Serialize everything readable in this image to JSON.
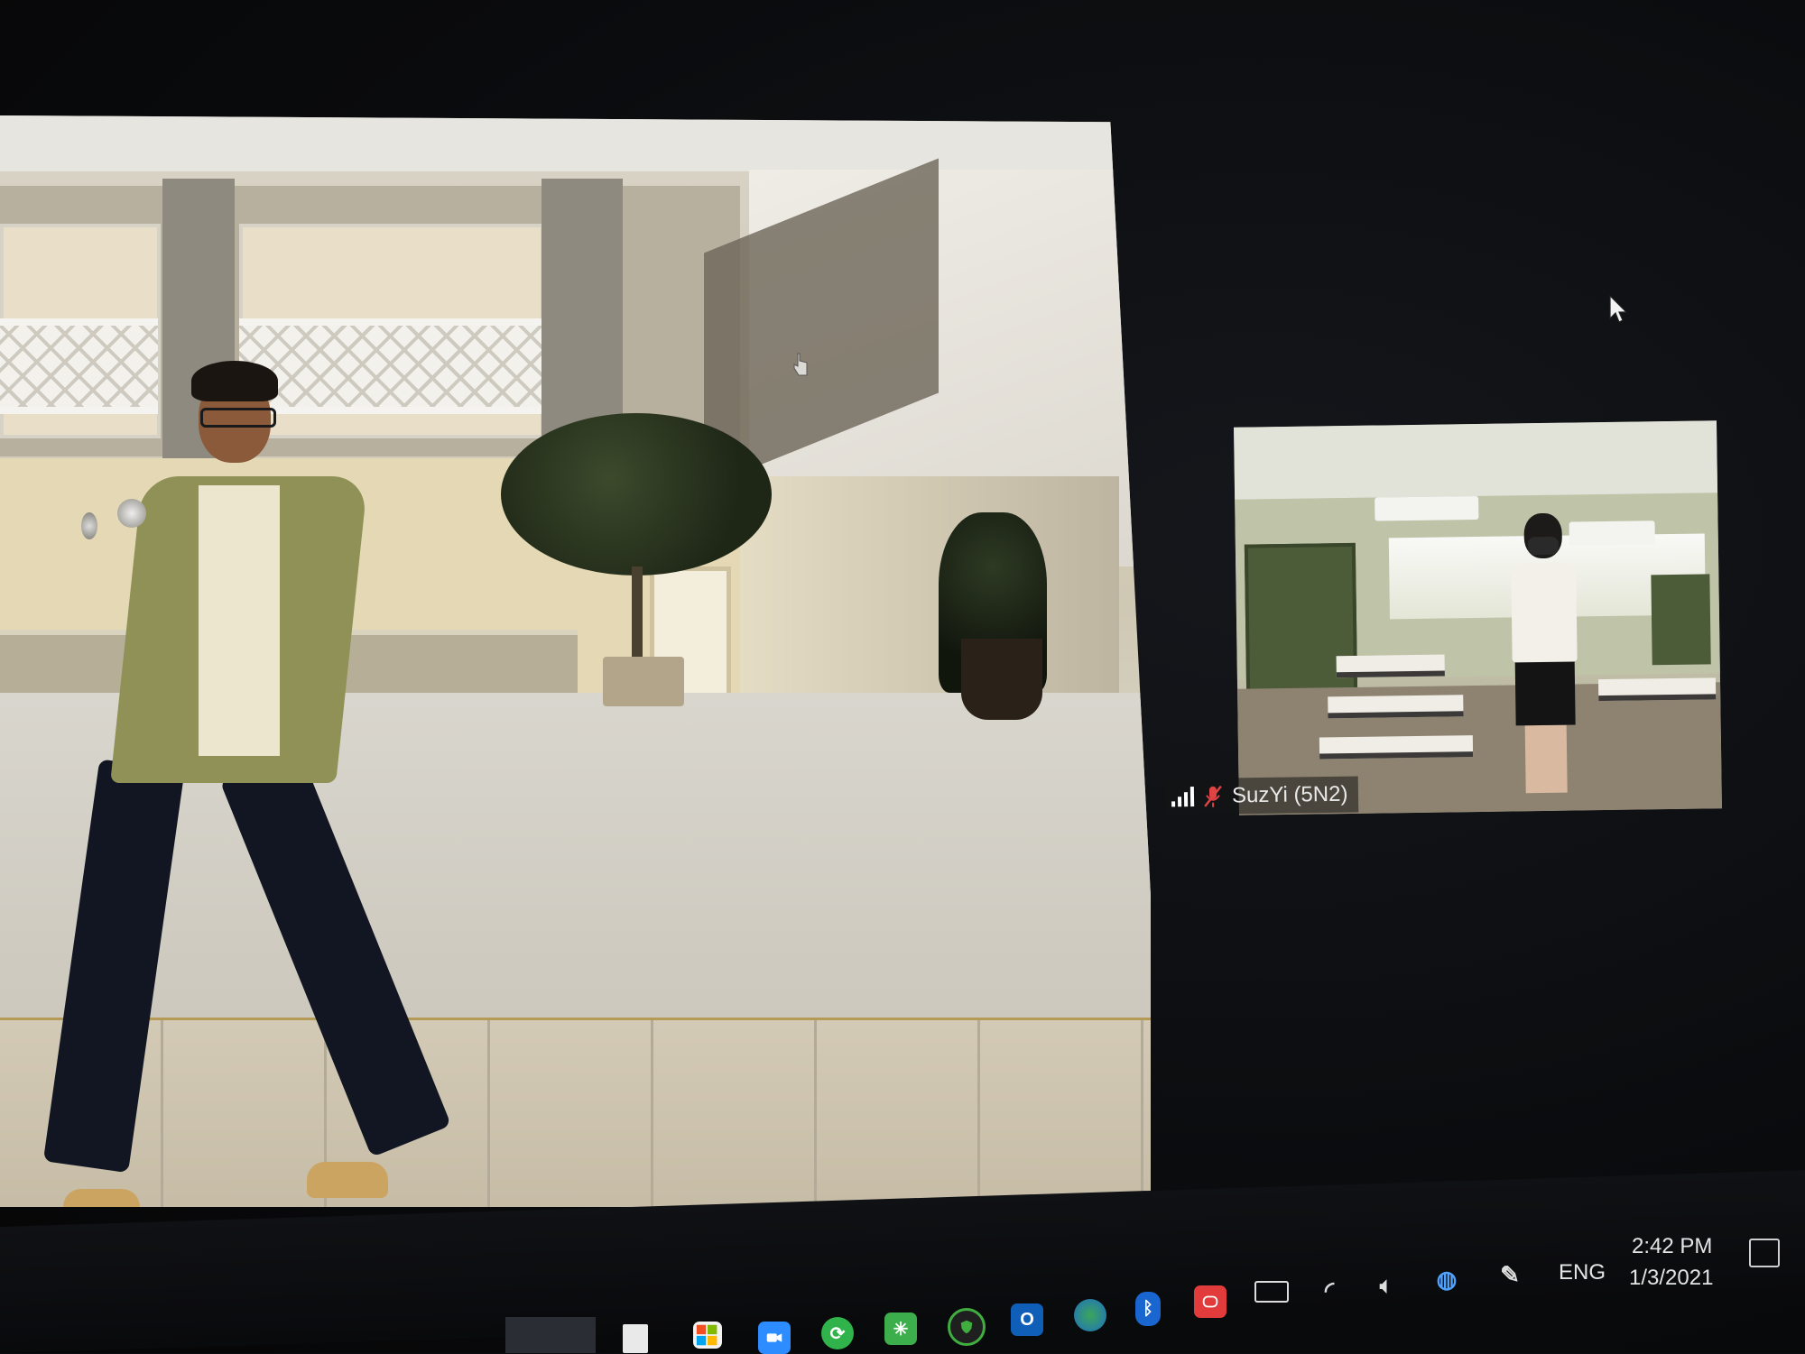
{
  "main_video": {
    "description_hidden": ""
  },
  "participant_tile": {
    "name": "SuzYi (5N2)",
    "mic_state": "muted"
  },
  "taskbar": {
    "icons": [
      "file-icon",
      "store-icon",
      "zoom-icon",
      "sync-icon",
      "snip-icon",
      "defender-icon",
      "outlook-icon",
      "browser-icon",
      "bluetooth-icon",
      "recording-icon",
      "battery-icon",
      "wifi-icon",
      "volume-icon",
      "onedrive-icon",
      "pen-icon"
    ],
    "language": "ENG",
    "time": "2:42 PM",
    "date": "1/3/2021"
  },
  "colors": {
    "zoom_blue": "#2d8cff",
    "muted_red": "#e04343",
    "background": "#0b0c0f"
  }
}
